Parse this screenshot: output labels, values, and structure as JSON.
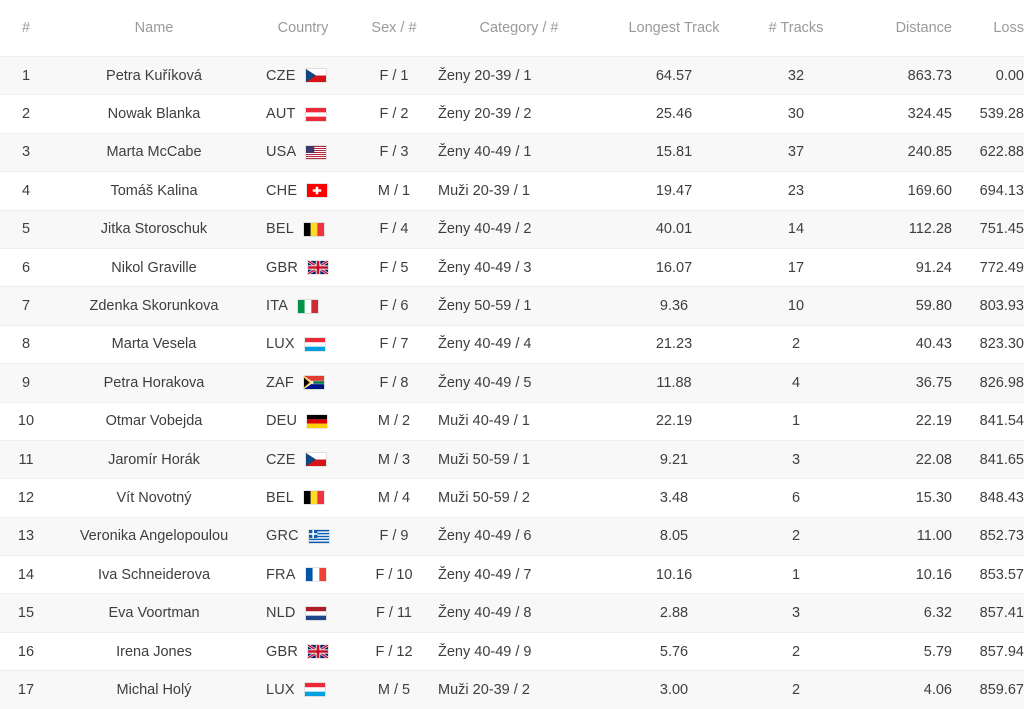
{
  "table": {
    "headers": [
      {
        "key": "rank",
        "label": "#"
      },
      {
        "key": "name",
        "label": "Name"
      },
      {
        "key": "country",
        "label": "Country"
      },
      {
        "key": "sex",
        "label": "Sex / #"
      },
      {
        "key": "category",
        "label": "Category / #"
      },
      {
        "key": "longest",
        "label": "Longest Track"
      },
      {
        "key": "tracks",
        "label": "# Tracks"
      },
      {
        "key": "distance",
        "label": "Distance"
      },
      {
        "key": "loss",
        "label": "Loss"
      }
    ],
    "rows": [
      {
        "rank": "1",
        "name": "Petra Kuříková",
        "country": "CZE",
        "flag": "flag-cze",
        "sex": "F / 1",
        "category": "Ženy 20-39 / 1",
        "longest": "64.57",
        "tracks": "32",
        "distance": "863.73",
        "loss": "0.00"
      },
      {
        "rank": "2",
        "name": "Nowak Blanka",
        "country": "AUT",
        "flag": "flag-aut",
        "sex": "F / 2",
        "category": "Ženy 20-39 / 2",
        "longest": "25.46",
        "tracks": "30",
        "distance": "324.45",
        "loss": "539.28"
      },
      {
        "rank": "3",
        "name": "Marta McCabe",
        "country": "USA",
        "flag": "flag-usa",
        "sex": "F / 3",
        "category": "Ženy 40-49 / 1",
        "longest": "15.81",
        "tracks": "37",
        "distance": "240.85",
        "loss": "622.88"
      },
      {
        "rank": "4",
        "name": "Tomáš Kalina",
        "country": "CHE",
        "flag": "flag-che",
        "sex": "M / 1",
        "category": "Muži 20-39 / 1",
        "longest": "19.47",
        "tracks": "23",
        "distance": "169.60",
        "loss": "694.13"
      },
      {
        "rank": "5",
        "name": "Jitka Storoschuk",
        "country": "BEL",
        "flag": "flag-bel",
        "sex": "F / 4",
        "category": "Ženy 40-49 / 2",
        "longest": "40.01",
        "tracks": "14",
        "distance": "112.28",
        "loss": "751.45"
      },
      {
        "rank": "6",
        "name": "Nikol Graville",
        "country": "GBR",
        "flag": "flag-gbr",
        "sex": "F / 5",
        "category": "Ženy 40-49 / 3",
        "longest": "16.07",
        "tracks": "17",
        "distance": "91.24",
        "loss": "772.49"
      },
      {
        "rank": "7",
        "name": "Zdenka Skorunkova",
        "country": "ITA",
        "flag": "flag-ita",
        "sex": "F / 6",
        "category": "Ženy 50-59 / 1",
        "longest": "9.36",
        "tracks": "10",
        "distance": "59.80",
        "loss": "803.93"
      },
      {
        "rank": "8",
        "name": "Marta Vesela",
        "country": "LUX",
        "flag": "flag-lux",
        "sex": "F / 7",
        "category": "Ženy 40-49 / 4",
        "longest": "21.23",
        "tracks": "2",
        "distance": "40.43",
        "loss": "823.30"
      },
      {
        "rank": "9",
        "name": "Petra Horakova",
        "country": "ZAF",
        "flag": "flag-zaf",
        "sex": "F / 8",
        "category": "Ženy 40-49 / 5",
        "longest": "11.88",
        "tracks": "4",
        "distance": "36.75",
        "loss": "826.98"
      },
      {
        "rank": "10",
        "name": "Otmar Vobejda",
        "country": "DEU",
        "flag": "flag-deu",
        "sex": "M / 2",
        "category": "Muži 40-49 / 1",
        "longest": "22.19",
        "tracks": "1",
        "distance": "22.19",
        "loss": "841.54"
      },
      {
        "rank": "11",
        "name": "Jaromír Horák",
        "country": "CZE",
        "flag": "flag-cze",
        "sex": "M / 3",
        "category": "Muži 50-59 / 1",
        "longest": "9.21",
        "tracks": "3",
        "distance": "22.08",
        "loss": "841.65"
      },
      {
        "rank": "12",
        "name": "Vít Novotný",
        "country": "BEL",
        "flag": "flag-bel",
        "sex": "M / 4",
        "category": "Muži 50-59 / 2",
        "longest": "3.48",
        "tracks": "6",
        "distance": "15.30",
        "loss": "848.43"
      },
      {
        "rank": "13",
        "name": "Veronika Angelopoulou",
        "country": "GRC",
        "flag": "flag-grc",
        "sex": "F / 9",
        "category": "Ženy 40-49 / 6",
        "longest": "8.05",
        "tracks": "2",
        "distance": "11.00",
        "loss": "852.73"
      },
      {
        "rank": "14",
        "name": "Iva Schneiderova",
        "country": "FRA",
        "flag": "flag-fra",
        "sex": "F / 10",
        "category": "Ženy 40-49 / 7",
        "longest": "10.16",
        "tracks": "1",
        "distance": "10.16",
        "loss": "853.57"
      },
      {
        "rank": "15",
        "name": "Eva Voortman",
        "country": "NLD",
        "flag": "flag-nld",
        "sex": "F / 11",
        "category": "Ženy 40-49 / 8",
        "longest": "2.88",
        "tracks": "3",
        "distance": "6.32",
        "loss": "857.41"
      },
      {
        "rank": "16",
        "name": "Irena Jones",
        "country": "GBR",
        "flag": "flag-gbr",
        "sex": "F / 12",
        "category": "Ženy 40-49 / 9",
        "longest": "5.76",
        "tracks": "2",
        "distance": "5.79",
        "loss": "857.94"
      },
      {
        "rank": "17",
        "name": "Michal Holý",
        "country": "LUX",
        "flag": "flag-lux",
        "sex": "M / 5",
        "category": "Muži 20-39 / 2",
        "longest": "3.00",
        "tracks": "2",
        "distance": "4.06",
        "loss": "859.67"
      }
    ]
  },
  "colors": {
    "header_text": "#9a9a9a",
    "body_text": "#3e3e3e",
    "row_alt_bg": "#f8f8f8",
    "row_bg": "#ffffff",
    "row_border": "#eeeeee"
  }
}
